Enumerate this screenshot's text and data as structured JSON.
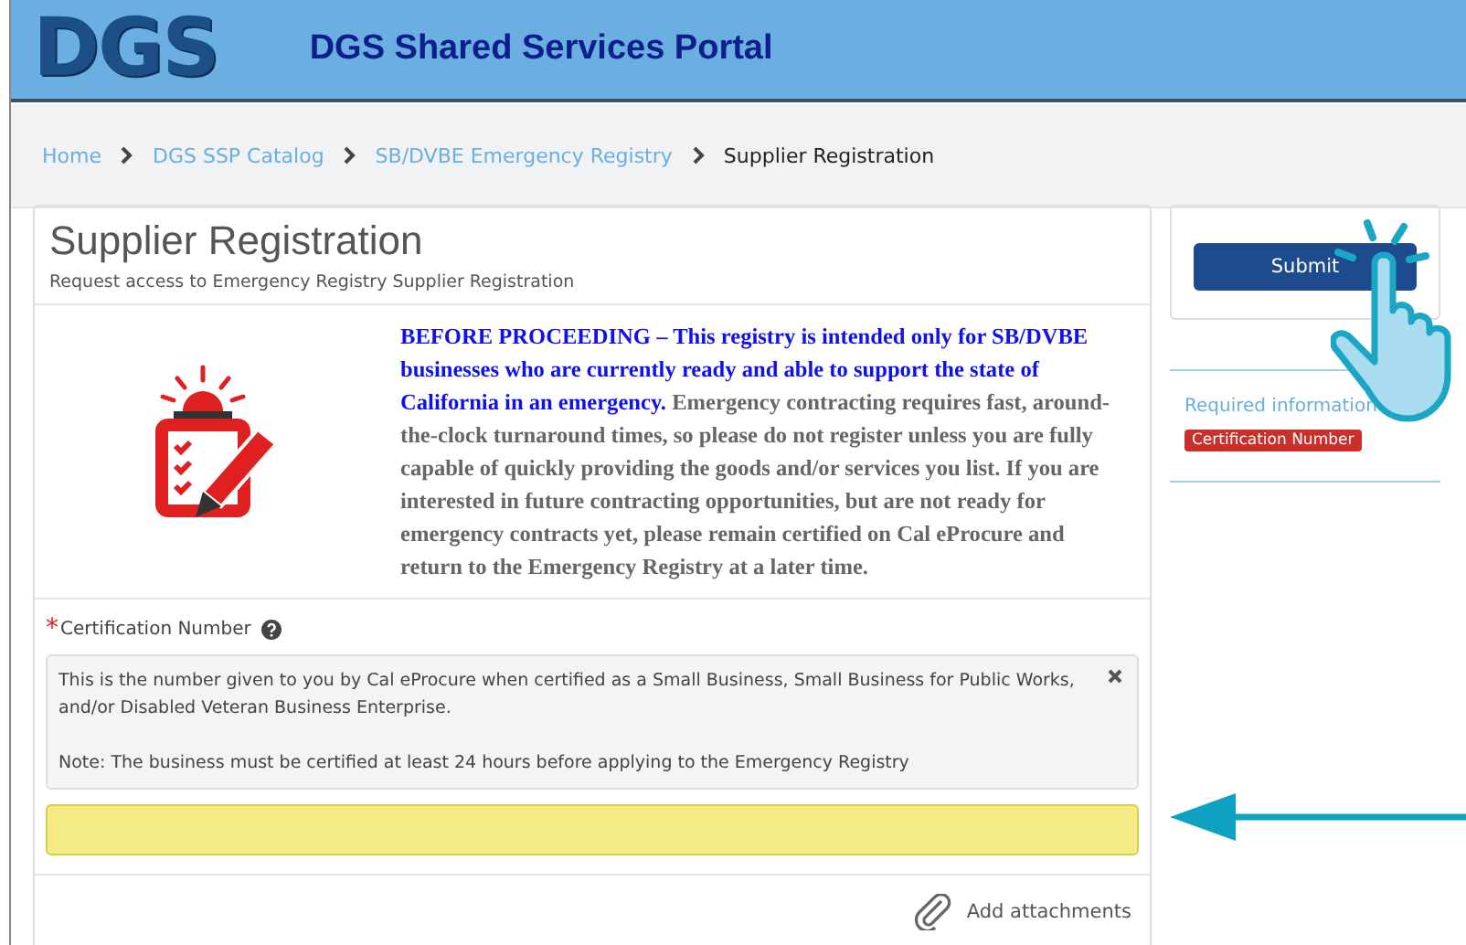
{
  "header": {
    "logo": "DGS",
    "title": "DGS Shared Services Portal"
  },
  "breadcrumb": [
    {
      "label": "Home",
      "kind": "link"
    },
    {
      "label": "DGS SSP Catalog",
      "kind": "link"
    },
    {
      "label": "SB/DVBE Emergency Registry",
      "kind": "link"
    },
    {
      "label": "Supplier Registration",
      "kind": "current"
    }
  ],
  "form": {
    "title": "Supplier Registration",
    "subtitle": "Request access to Emergency Registry Supplier Registration",
    "notice": {
      "highlight": "BEFORE PROCEEDING – This registry is intended only for SB/DVBE businesses who are currently ready and able to support the state of California in an emergency.",
      "body": "Emergency contracting requires fast, around-the-clock turnaround times, so please do not register unless you are fully capable of quickly providing the goods and/or services you list. If you are interested in future contracting opportunities, but are not ready for emergency contracts yet, please remain certified on Cal eProcure and return to the Emergency Registry at a later time."
    },
    "field": {
      "required_mark": "*",
      "label": "Certification Number",
      "help_lines": [
        "This is the number given to you by Cal eProcure when certified as a Small Business, Small Business for Public Works, and/or Disabled Veteran Business Enterprise.",
        "Note: The business must be certified at least 24 hours before applying to the Emergency Registry"
      ],
      "highlighted": true
    },
    "attachments": "Add attachments"
  },
  "sidebar": {
    "submit": "Submit",
    "required_title": "Required information",
    "required_items": [
      "Certification Number"
    ]
  }
}
